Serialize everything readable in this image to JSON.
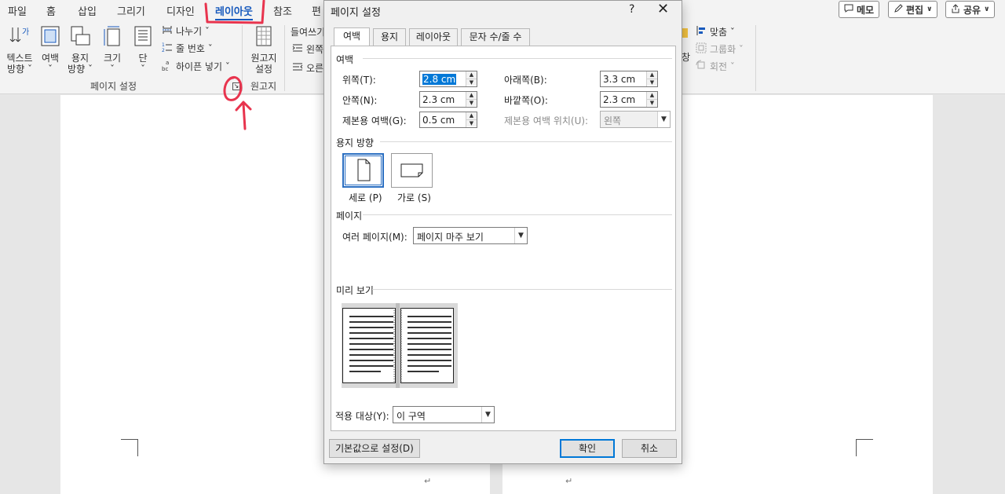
{
  "menu": {
    "tabs": [
      "파일",
      "홈",
      "삽입",
      "그리기",
      "디자인",
      "레이아웃",
      "참조",
      "편"
    ],
    "active": "레이아웃",
    "comment_button": "메모",
    "edit_button": "편집",
    "share_button": "공유"
  },
  "ribbon": {
    "page_setup": {
      "text_direction": "텍스트\n방향 ˇ",
      "margins": "여백\nˇ",
      "orientation": "용지\n방향 ˇ",
      "size": "크기\nˇ",
      "columns": "단\nˇ",
      "breaks": "나누기 ˇ",
      "line_numbers": "줄 번호 ˇ",
      "hyphenation": "하이픈 넣기 ˇ",
      "group_label": "페이지 설정"
    },
    "manuscript": {
      "button": "원고지\n설정",
      "group_label": "원고지"
    },
    "paragraph": {
      "indent_label": "들여쓰기",
      "left": "왼쪽",
      "right": "오른"
    },
    "arrange": {
      "wrap": "창",
      "align": "맞춤 ˇ",
      "group": "그룹화 ˇ",
      "rotate": "회전 ˇ"
    }
  },
  "dialog": {
    "title": "페이지 설정",
    "help": "?",
    "close": "✕",
    "tabs": [
      "여백",
      "용지",
      "레이아웃",
      "문자 수/줄 수"
    ],
    "selected_tab": "여백",
    "margins_section": "여백",
    "top_label": "위쪽(T):",
    "top_value": "2.8 cm",
    "bottom_label": "아래쪽(B):",
    "bottom_value": "3.3 cm",
    "inside_label": "안쪽(N):",
    "inside_value": "2.3 cm",
    "outside_label": "바깥쪽(O):",
    "outside_value": "2.3 cm",
    "gutter_label": "제본용 여백(G):",
    "gutter_value": "0.5 cm",
    "gutter_pos_label": "제본용 여백 위치(U):",
    "gutter_pos_value": "왼쪽",
    "orientation_section": "용지 방향",
    "portrait_label": "세로 (P)",
    "landscape_label": "가로 (S)",
    "pages_section": "페이지",
    "multiple_pages_label": "여러 페이지(M):",
    "multiple_pages_value": "페이지 마주 보기",
    "preview_section": "미리 보기",
    "apply_to_label": "적용 대상(Y):",
    "apply_to_value": "이 구역",
    "default_button": "기본값으로 설정(D)",
    "ok_button": "확인",
    "cancel_button": "취소"
  },
  "colors": {
    "accent": "#185abd",
    "annotation": "#e8344e",
    "selection": "#0078d7"
  },
  "document": {
    "para_mark": "↵"
  }
}
